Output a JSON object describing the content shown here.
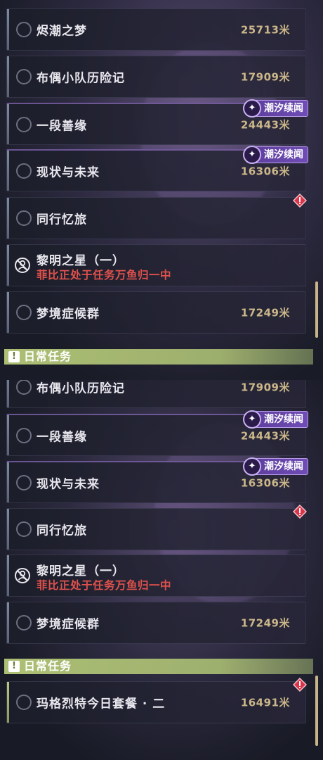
{
  "panel_top": {
    "quests": [
      {
        "title": "烬潮之梦",
        "distance": "25713米"
      },
      {
        "title": "布偶小队历险记",
        "distance": "17909米"
      },
      {
        "title": "一段善缘",
        "distance": "24443米",
        "tag": "潮汐续闻"
      },
      {
        "title": "现状与未来",
        "distance": "16306米",
        "tag": "潮汐续闻"
      },
      {
        "title": "同行忆旅",
        "alert": true
      },
      {
        "title": "黎明之星（一）",
        "subtitle": "菲比正处于任务万鱼归一中"
      },
      {
        "title": "梦境症候群",
        "distance": "17249米"
      }
    ],
    "section_label": "日常任务"
  },
  "panel_bottom": {
    "quests": [
      {
        "title": "布偶小队历险记",
        "distance": "17909米"
      },
      {
        "title": "一段善缘",
        "distance": "24443米",
        "tag": "潮汐续闻"
      },
      {
        "title": "现状与未来",
        "distance": "16306米",
        "tag": "潮汐续闻"
      },
      {
        "title": "同行忆旅",
        "alert": true
      },
      {
        "title": "黎明之星（一）",
        "subtitle": "菲比正处于任务万鱼归一中"
      },
      {
        "title": "梦境症候群",
        "distance": "17249米"
      }
    ],
    "section_label": "日常任务",
    "daily": [
      {
        "title": "玛格烈特今日套餐 · 二",
        "distance": "16491米",
        "alert": true
      }
    ]
  },
  "colors": {
    "distance": "#cbb789",
    "subtitle_red": "#e0514c",
    "tag_purple": "#6f4db5",
    "section_green": "#b4c878",
    "alert_red": "#d9344a"
  },
  "icons": {
    "tag": "sparkle-icon",
    "alert": "exclamation-diamond-icon",
    "special": "blocked-person-icon",
    "section": "exclamation-box-icon"
  }
}
